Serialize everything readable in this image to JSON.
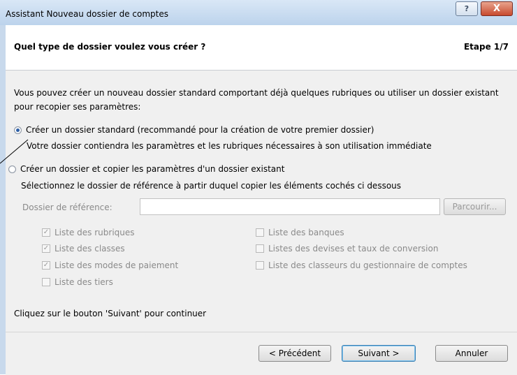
{
  "window": {
    "title": "Assistant Nouveau dossier de comptes",
    "help_glyph": "?",
    "close_glyph": "X"
  },
  "header": {
    "title": "Quel type de dossier voulez vous créer ?",
    "step": "Etape 1/7"
  },
  "intro_text": "Vous pouvez créer un nouveau dossier standard comportant déjà quelques rubriques ou utiliser un dossier existant pour recopier ses paramètres:",
  "option_standard": {
    "label": "Créer un dossier standard (recommandé pour la création de votre premier dossier)",
    "description": "Votre dossier contiendra les paramètres et les rubriques nécessaires à son utilisation immédiate",
    "checked": true
  },
  "option_copy": {
    "label": "Créer un dossier et copier les paramètres d'un dossier existant",
    "description": "Sélectionnez le dossier de référence à partir duquel copier les éléments cochés ci dessous",
    "checked": false
  },
  "reference_field": {
    "label": "Dossier de référence:",
    "value": "",
    "browse_label": "Parcourir..."
  },
  "checklists": {
    "left": [
      {
        "label": "Liste des rubriques",
        "checked": true
      },
      {
        "label": "Liste des classes",
        "checked": true
      },
      {
        "label": "Liste des modes de paiement",
        "checked": true
      },
      {
        "label": "Liste des tiers",
        "checked": false
      }
    ],
    "right": [
      {
        "label": "Liste des banques",
        "checked": false
      },
      {
        "label": "Listes des devises et taux de conversion",
        "checked": false
      },
      {
        "label": "Liste des classeurs du gestionnaire de comptes",
        "checked": false
      }
    ]
  },
  "footer_note": "Cliquez sur le bouton 'Suivant' pour continuer",
  "buttons": {
    "previous": "< Précédent",
    "next": "Suivant >",
    "cancel": "Annuler"
  },
  "colors": {
    "title_bar": "#bcd3ec",
    "close_button": "#c74a2e",
    "body_background": "#f0f0f0",
    "radio_checked": "#2c5ea6"
  }
}
